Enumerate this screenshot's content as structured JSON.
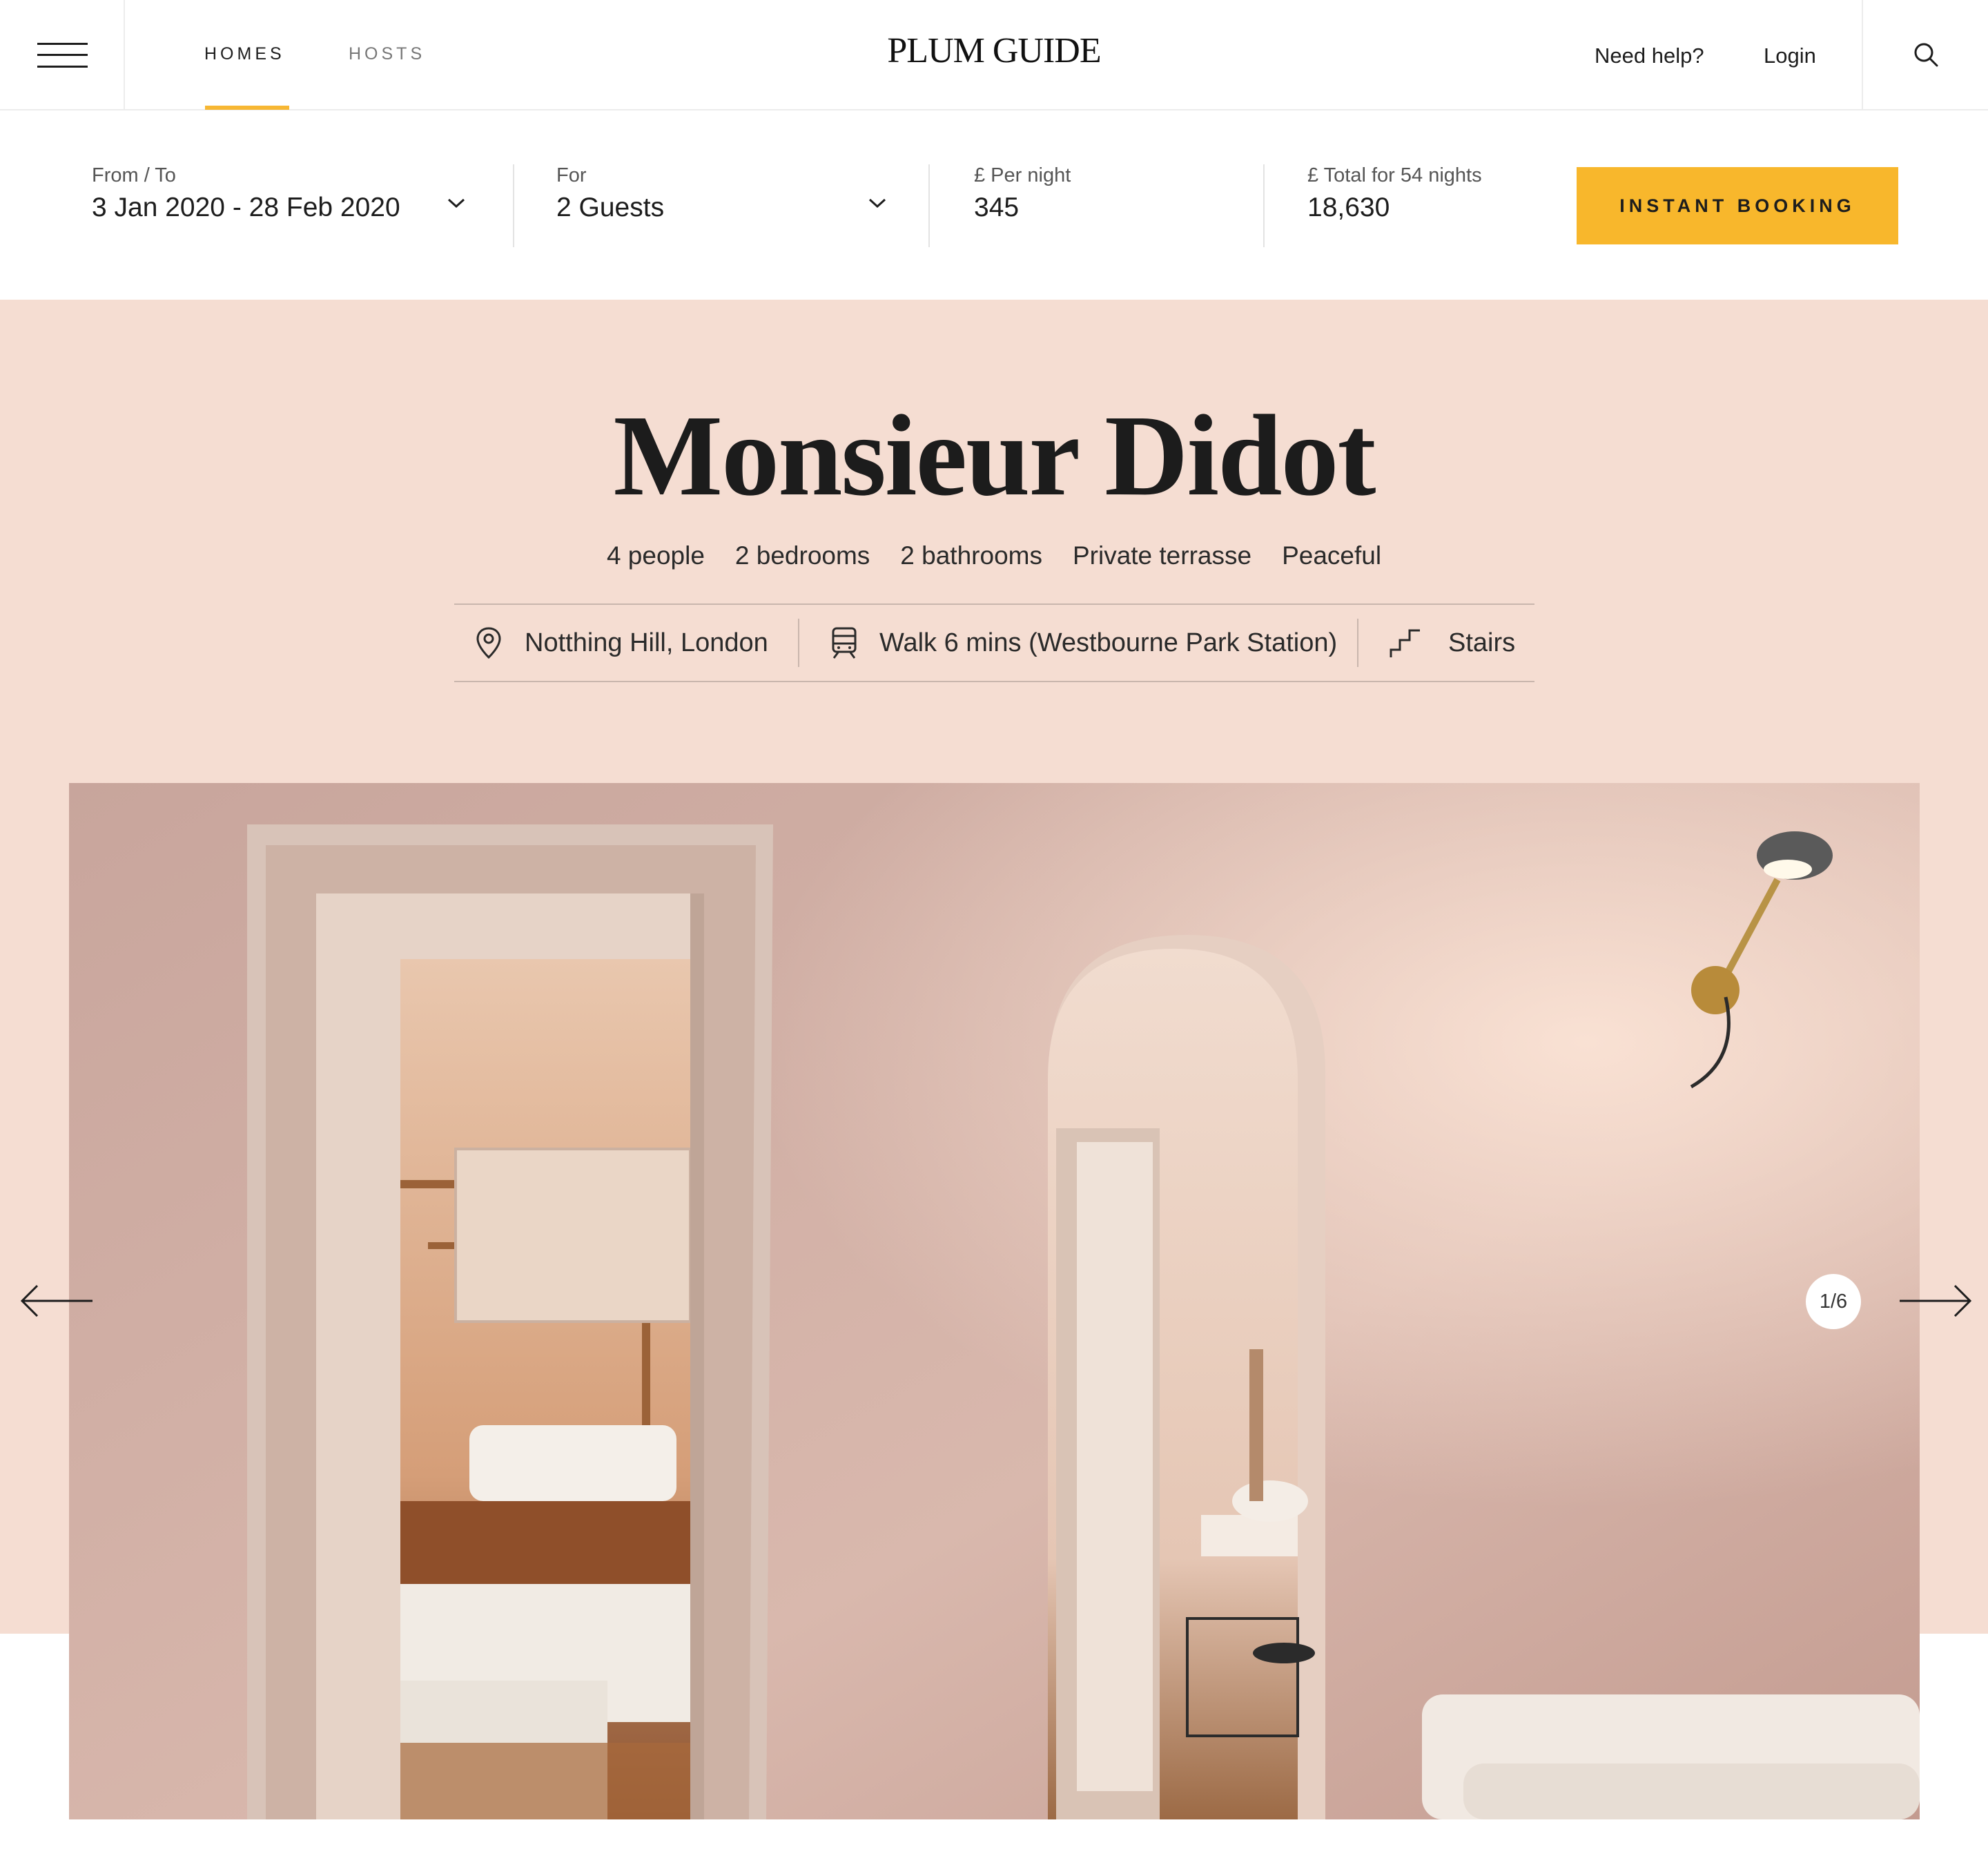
{
  "nav": {
    "tabs": [
      {
        "label": "HOMES",
        "active": true
      },
      {
        "label": "HOSTS",
        "active": false
      }
    ],
    "logo": "PLUM GUIDE",
    "help": "Need help?",
    "login": "Login"
  },
  "booking": {
    "dates_label": "From / To",
    "dates_value": "3 Jan 2020 - 28 Feb 2020",
    "guests_label": "For",
    "guests_value": "2 Guests",
    "per_night_label": "£ Per night",
    "per_night_value": "345",
    "total_label": "£ Total for 54 nights",
    "total_value": "18,630",
    "cta": "INSTANT BOOKING"
  },
  "listing": {
    "title": "Monsieur Didot",
    "features": [
      "4 people",
      "2 bedrooms",
      "2 bathrooms",
      "Private terrasse",
      "Peaceful"
    ],
    "location": "Notthing Hill, London",
    "transport": "Walk 6 mins (Westbourne Park Station)",
    "access": "Stairs"
  },
  "gallery": {
    "counter": "1/6"
  },
  "colors": {
    "accent": "#f8b72c",
    "hero_bg": "#f5ddd2",
    "text": "#1d1d1d"
  }
}
